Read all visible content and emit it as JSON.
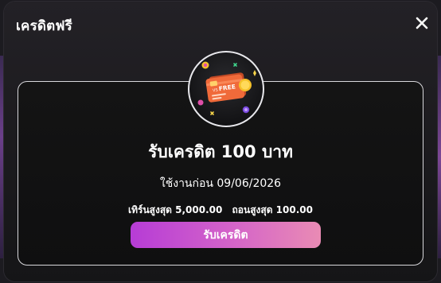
{
  "modal": {
    "title": "เครดิตฟรี",
    "close_icon": "close-icon"
  },
  "badge": {
    "icon": "free-credit-card-icon",
    "card_label": "FREE",
    "card_chip_text": "VS",
    "colors": {
      "card": "#f06a3a",
      "coin": "#f5c12a",
      "sparkle_green": "#3fd28a",
      "sparkle_pink": "#e04fa8",
      "sparkle_yellow": "#f5d34a"
    }
  },
  "offer": {
    "headline": "รับเครดิต 100 บาท",
    "expiry": "ใช้งานก่อน 09/06/2026",
    "max_turnover": "เทิร์นสูงสุด 5,000.00",
    "max_withdraw": "ถอนสูงสุด 100.00"
  },
  "claim_button": {
    "label": "รับเครดิต"
  },
  "theme": {
    "accent_gradient": [
      "#b63cd6",
      "#e98bb4"
    ],
    "background": "#1c1b20"
  }
}
